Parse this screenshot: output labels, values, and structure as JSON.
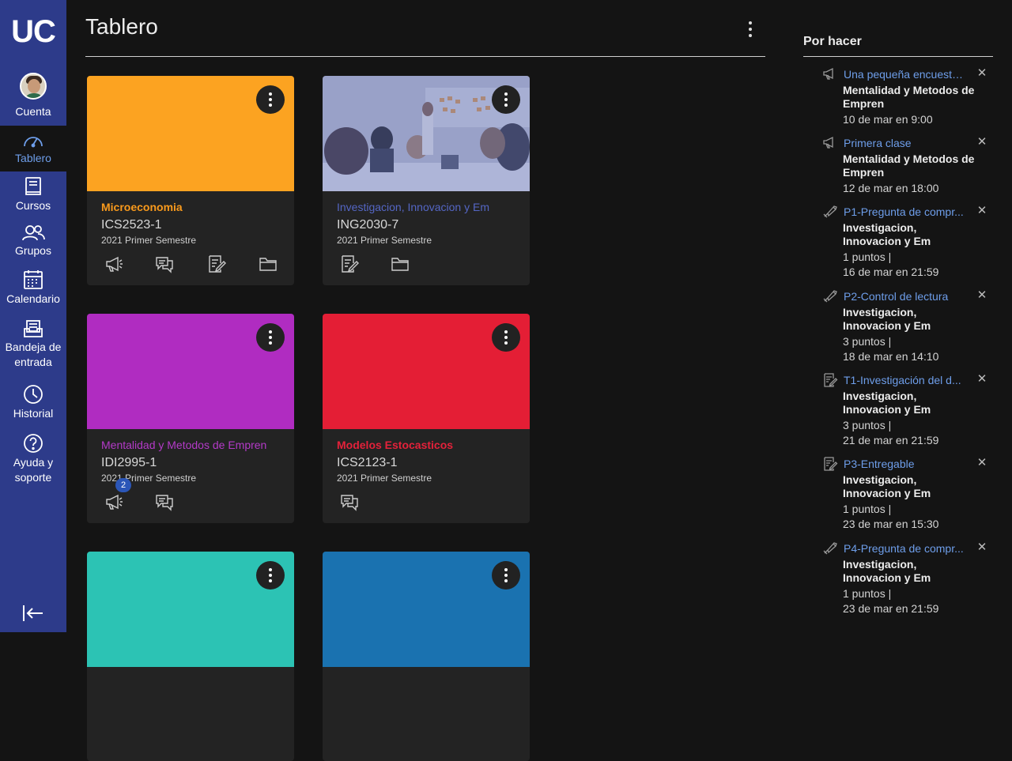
{
  "nav": {
    "logo": "UC",
    "items": [
      {
        "label": "Cuenta"
      },
      {
        "label": "Tablero"
      },
      {
        "label": "Cursos"
      },
      {
        "label": "Grupos"
      },
      {
        "label": "Calendario"
      },
      {
        "label": "Bandeja de entrada"
      },
      {
        "label": "Historial"
      },
      {
        "label": "Ayuda y soporte"
      }
    ]
  },
  "header": {
    "title": "Tablero"
  },
  "cards": [
    {
      "name": "Microeconomia",
      "code": "ICS2523-1",
      "term": "2021 Primer Semestre",
      "color": "#fca321",
      "name_color": "#f99a1c"
    },
    {
      "name": "Investigacion, Innovacion y Em",
      "code": "ING2030-7",
      "term": "2021 Primer Semestre",
      "color": "#4b5cae",
      "name_color": "#5466c4"
    },
    {
      "name": "Mentalidad y Metodos de Empren",
      "code": "IDI2995-1",
      "term": "2021 Primer Semestre",
      "color": "#b02cc1",
      "name_color": "#b43ac8",
      "badge": "2"
    },
    {
      "name": "Modelos Estocasticos",
      "code": "ICS2123-1",
      "term": "2021 Primer Semestre",
      "color": "#e41e35",
      "name_color": "#e4213a"
    },
    {
      "color": "#2cc3b4"
    },
    {
      "color": "#1a72b0"
    }
  ],
  "todo": {
    "title": "Por hacer",
    "items": [
      {
        "icon": "announcement-icon",
        "title": "Una pequeña encuesta...",
        "course": "Mentalidad y Metodos de Empren",
        "date": "10 de mar en 9:00"
      },
      {
        "icon": "announcement-icon",
        "title": "Primera clase",
        "course": "Mentalidad y Metodos de Empren",
        "date": "12 de mar en 18:00"
      },
      {
        "icon": "quiz-icon",
        "title": "P1-Pregunta de compr...",
        "course": "Investigacion, Innovacion y Em",
        "points": "1 puntos  |",
        "date": "16 de mar en 21:59"
      },
      {
        "icon": "quiz-icon",
        "title": "P2-Control de lectura",
        "course": "Investigacion, Innovacion y Em",
        "points": "3 puntos  |",
        "date": "18 de mar en 14:10"
      },
      {
        "icon": "assignment-icon",
        "title": "T1-Investigación del d...",
        "course": "Investigacion, Innovacion y Em",
        "points": "3 puntos  |",
        "date": "21 de mar en 21:59"
      },
      {
        "icon": "assignment-icon",
        "title": "P3-Entregable",
        "course": "Investigacion, Innovacion y Em",
        "points": "1 puntos  |",
        "date": "23 de mar en 15:30"
      },
      {
        "icon": "quiz-icon",
        "title": "P4-Pregunta de compr...",
        "course": "Investigacion, Innovacion y Em",
        "points": "1 puntos  |",
        "date": "23 de mar en 21:59"
      }
    ]
  }
}
